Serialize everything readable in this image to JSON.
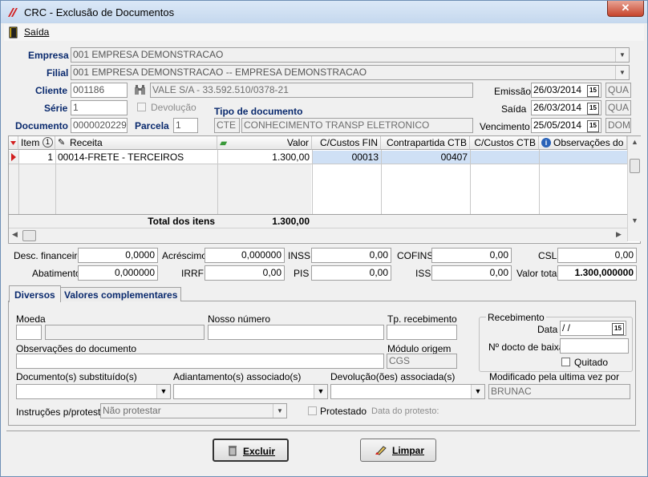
{
  "window": {
    "title": "CRC - Exclusão de Documentos",
    "close": "✕"
  },
  "menu": {
    "exit": "Saída"
  },
  "form": {
    "empresa_label": "Empresa",
    "empresa_value": "001 EMPRESA DEMONSTRACAO",
    "filial_label": "Filial",
    "filial_value": "001 EMPRESA DEMONSTRACAO -- EMPRESA DEMONSTRACAO",
    "cliente_label": "Cliente",
    "cliente_code": "001186",
    "cliente_name": "VALE S/A - 33.592.510/0378-21",
    "serie_label": "Série",
    "serie_value": "1",
    "devolucao_label": "Devolução",
    "documento_label": "Documento",
    "documento_value": "0000020229",
    "parcela_label": "Parcela",
    "parcela_value": "1",
    "tipo_doc_label": "Tipo de documento",
    "tipo_doc_code": "CTE",
    "tipo_doc_name": "CONHECIMENTO TRANSP ELETRONICO",
    "emissao_label": "Emissão",
    "emissao_value": "26/03/2014",
    "emissao_day": "QUA",
    "saida_label": "Saída",
    "saida_value": "26/03/2014",
    "saida_day": "QUA",
    "vencimento_label": "Vencimento",
    "vencimento_value": "25/05/2014",
    "vencimento_day": "DOM",
    "cal_glyph": "15"
  },
  "grid": {
    "headers": [
      "Item",
      "Receita",
      "Valor",
      "C/Custos FIN",
      "Contrapartida CTB",
      "C/Custos CTB",
      "Observações do it"
    ],
    "rows": [
      {
        "item": "1",
        "receita": "00014-FRETE - TERCEIROS",
        "valor": "1.300,00",
        "ccfin": "00013",
        "contrapartida": "00407",
        "ccctb": "",
        "obs": ""
      }
    ],
    "total_label": "Total dos itens",
    "total_value": "1.300,00"
  },
  "totals": {
    "desc_fin_label": "Desc. financeiro",
    "desc_fin": "0,0000",
    "acrescimo_label": "Acréscimo",
    "acrescimo": "0,000000",
    "inss_label": "INSS",
    "inss": "0,00",
    "cofins_label": "COFINS",
    "cofins": "0,00",
    "csl_label": "CSL",
    "csl": "0,00",
    "abatimento_label": "Abatimento",
    "abatimento": "0,000000",
    "irrf_label": "IRRF",
    "irrf": "0,00",
    "pis_label": "PIS",
    "pis": "0,00",
    "iss_label": "ISS",
    "iss": "0,00",
    "valor_total_label": "Valor total",
    "valor_total": "1.300,000000"
  },
  "tabs": [
    "Diversos",
    "Valores complementares"
  ],
  "diversos": {
    "moeda_label": "Moeda",
    "nosso_numero_label": "Nosso número",
    "tp_recebimento_label": "Tp. recebimento",
    "recebimento_group": "Recebimento",
    "data_label": "Data",
    "data_value": " / /",
    "docto_baixa_label": "Nº docto de baixa",
    "quitado_label": "Quitado",
    "obs_doc_label": "Observações do documento",
    "modulo_origem_label": "Módulo origem",
    "modulo_origem_value": "CGS",
    "doc_subst_label": "Documento(s) substituído(s)",
    "adiantamento_label": "Adiantamento(s) associado(s)",
    "devolucao_assoc_label": "Devolução(ões) associada(s)",
    "modificado_label": "Modificado pela ultima vez por",
    "modificado_value": "BRUNAC",
    "instrucoes_label": "Instruções p/protesto",
    "instrucoes_value": "Não protestar",
    "protestado_label": "Protestado",
    "data_protesto_label": "Data do protesto:"
  },
  "buttons": {
    "excluir": "Excluir",
    "limpar": "Limpar"
  },
  "colors": {
    "accent": "#0a2a6e",
    "row_select": "#cfe0f5",
    "indicator": "#d21e1e"
  }
}
